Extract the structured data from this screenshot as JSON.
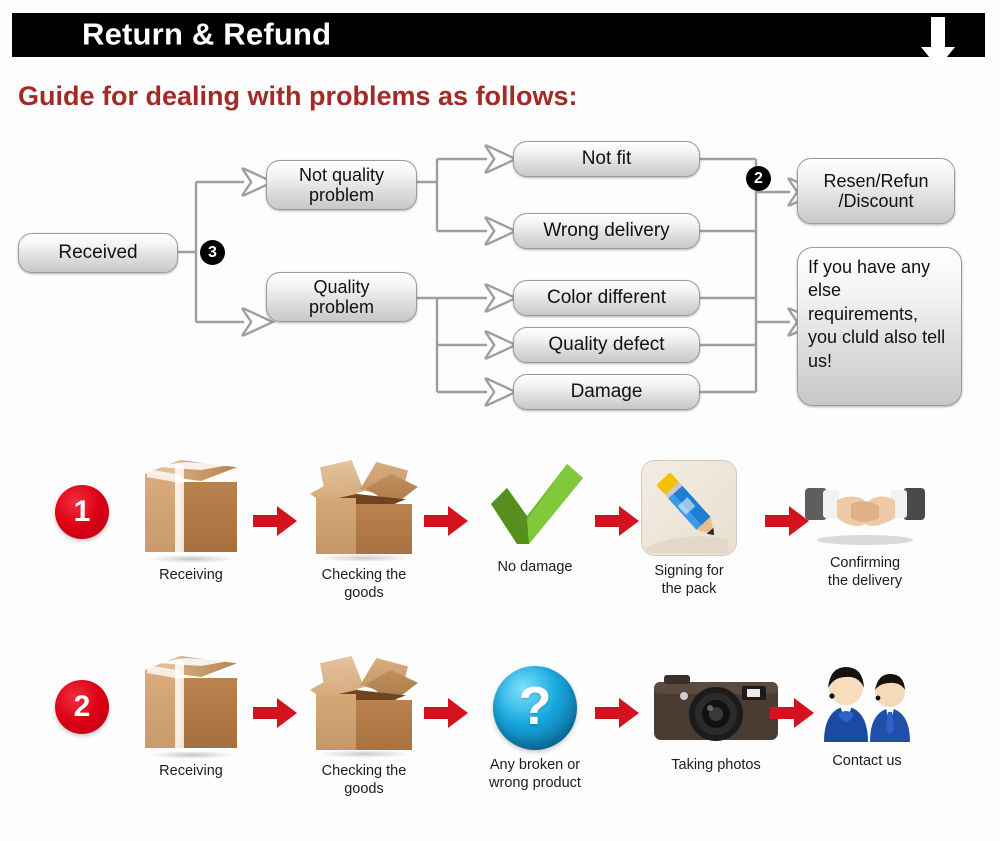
{
  "banner": {
    "title": "Return & Refund",
    "arrow_icon": "arrow-down-icon"
  },
  "guide": {
    "heading": "Guide for dealing with problems as follows:"
  },
  "colors": {
    "banner_background": "#000000",
    "banner_text": "#ffffff",
    "heading_text": "#A32B27",
    "red_accent": "#DD0015",
    "node_border": "#9a9a9a",
    "connector": "#9e9e9e"
  },
  "flowchart": {
    "nodes": {
      "received": "Received",
      "not_quality_problem": "Not quality\nproblem",
      "quality_problem": "Quality\nproblem",
      "not_fit": "Not fit",
      "wrong_delivery": "Wrong delivery",
      "color_different": "Color different",
      "quality_defect": "Quality defect",
      "damage": "Damage",
      "resend_refund": "Resen/Refun\n/Discount",
      "else_requirements": "If you have any else requirements, you cluld also tell us!"
    },
    "markers": {
      "branch_marker": "3",
      "outcome_marker": "2"
    }
  },
  "process_rows": [
    {
      "number": "1",
      "steps": [
        {
          "icon": "closed-box-icon",
          "label": "Receiving"
        },
        {
          "icon": "open-box-icon",
          "label": "Checking the\ngoods"
        },
        {
          "icon": "green-check-icon",
          "label": "No damage"
        },
        {
          "icon": "pencil-signing-icon",
          "label": "Signing for\nthe pack"
        },
        {
          "icon": "handshake-icon",
          "label": "Confirming\nthe delivery"
        }
      ]
    },
    {
      "number": "2",
      "steps": [
        {
          "icon": "closed-box-icon",
          "label": "Receiving"
        },
        {
          "icon": "open-box-icon",
          "label": "Checking the\ngoods"
        },
        {
          "icon": "question-mark-icon",
          "label": "Any broken or\nwrong product"
        },
        {
          "icon": "camera-icon",
          "label": "Taking photos"
        },
        {
          "icon": "support-agents-icon",
          "label": "Contact us"
        }
      ]
    }
  ]
}
